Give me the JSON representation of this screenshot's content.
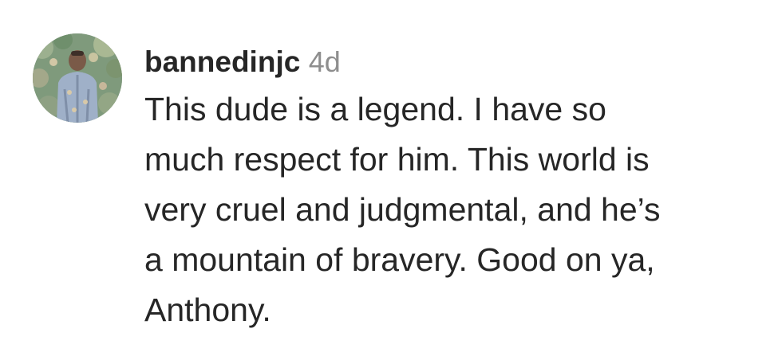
{
  "comment": {
    "username": "bannedinjc",
    "timestamp": "4d",
    "avatar_icon": "user-avatar-photo",
    "lines": [
      "This dude is a legend. I have so",
      "much respect for him. This world is",
      "very cruel and judgmental, and he’s",
      "a mountain of bravery. Good on ya,",
      "Anthony."
    ]
  }
}
